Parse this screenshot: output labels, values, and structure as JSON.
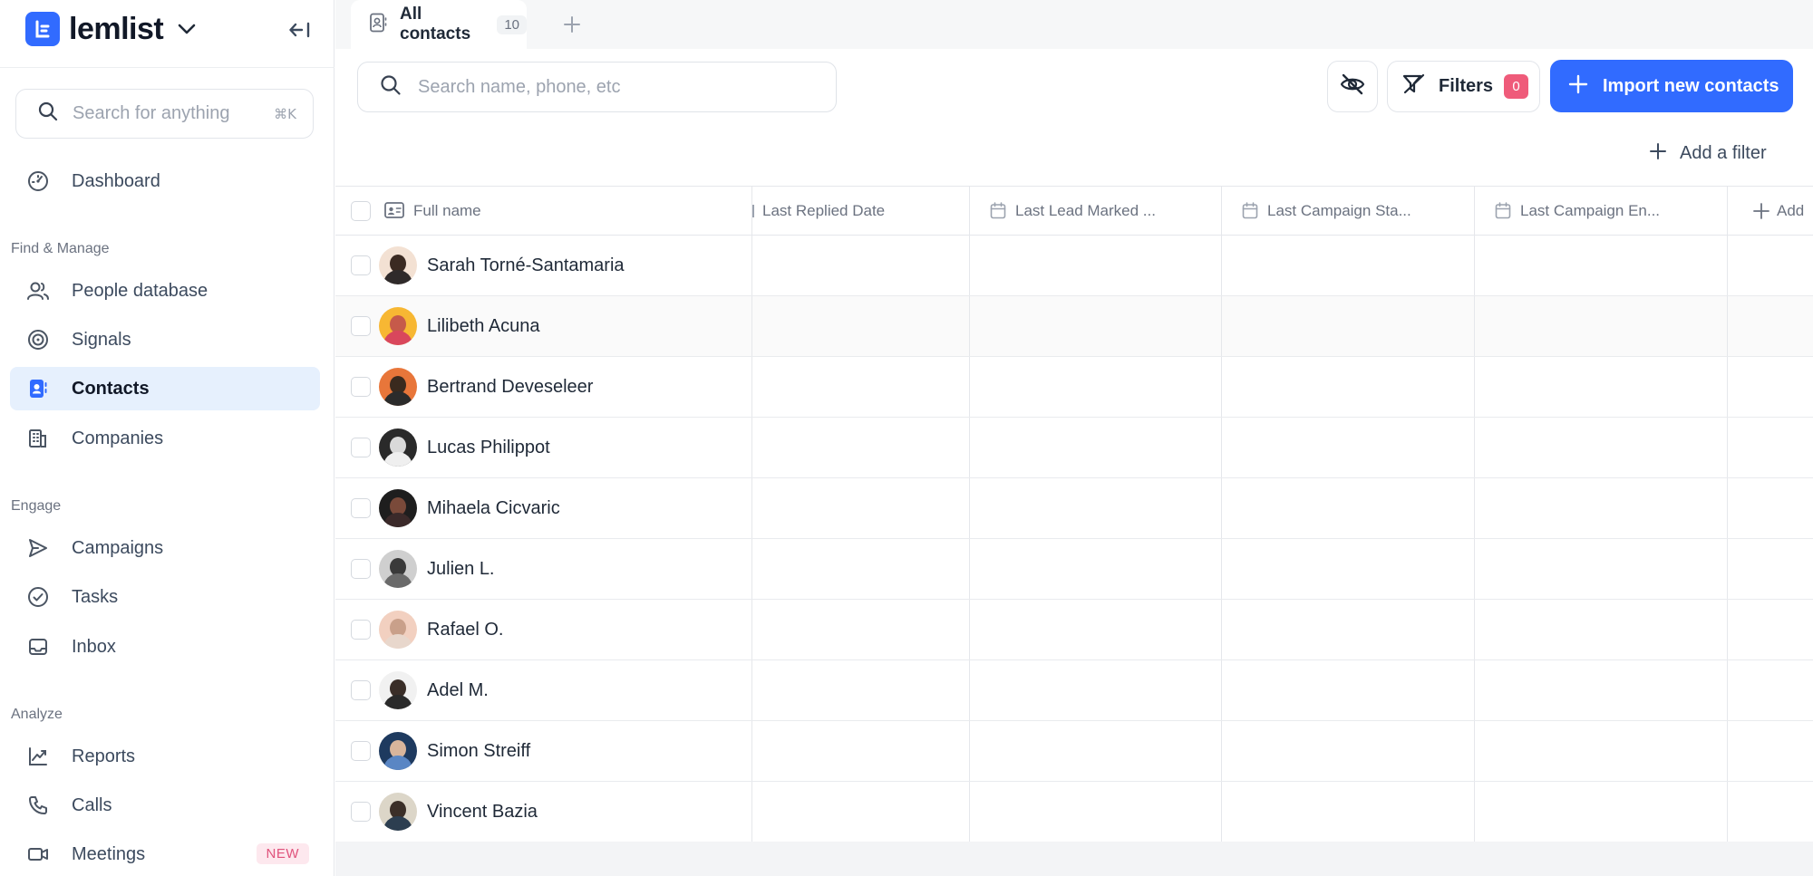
{
  "sidebar": {
    "brand": "lemlist",
    "search": {
      "placeholder": "Search for anything",
      "shortcut": "⌘K"
    },
    "dashboard": "Dashboard",
    "sections": {
      "find_manage": "Find & Manage",
      "engage": "Engage",
      "analyze": "Analyze"
    },
    "items": {
      "people_database": "People database",
      "signals": "Signals",
      "contacts": "Contacts",
      "companies": "Companies",
      "campaigns": "Campaigns",
      "tasks": "Tasks",
      "inbox": "Inbox",
      "reports": "Reports",
      "calls": "Calls",
      "meetings": "Meetings"
    },
    "meetings_badge": "NEW",
    "active_item": "contacts"
  },
  "tabs": [
    {
      "label": "All contacts",
      "count": "10"
    }
  ],
  "toolbar": {
    "search_placeholder": "Search name, phone, etc",
    "filters_label": "Filters",
    "filters_count": "0",
    "import_label": "Import new contacts",
    "add_filter_label": "Add a filter"
  },
  "table": {
    "columns": {
      "full_name": "Full name",
      "last_replied": "Last Replied Date",
      "last_lead_marked": "Last Lead Marked ...",
      "last_campaign_start": "Last Campaign Sta...",
      "last_campaign_end": "Last Campaign En...",
      "add": "Add"
    },
    "rows": [
      {
        "name": "Sarah Torné-Santamaria"
      },
      {
        "name": "Lilibeth Acuna"
      },
      {
        "name": "Bertrand Deveseleer"
      },
      {
        "name": "Lucas Philippot"
      },
      {
        "name": "Mihaela Cicvaric"
      },
      {
        "name": "Julien L."
      },
      {
        "name": "Rafael O."
      },
      {
        "name": "Adel M."
      },
      {
        "name": "Simon Streiff"
      },
      {
        "name": "Vincent Bazia"
      }
    ]
  },
  "colors": {
    "accent": "#316bff",
    "filter_badge": "#ef5b7a",
    "active_nav_bg": "#e6f0fd",
    "new_badge_text": "#e0537c"
  }
}
